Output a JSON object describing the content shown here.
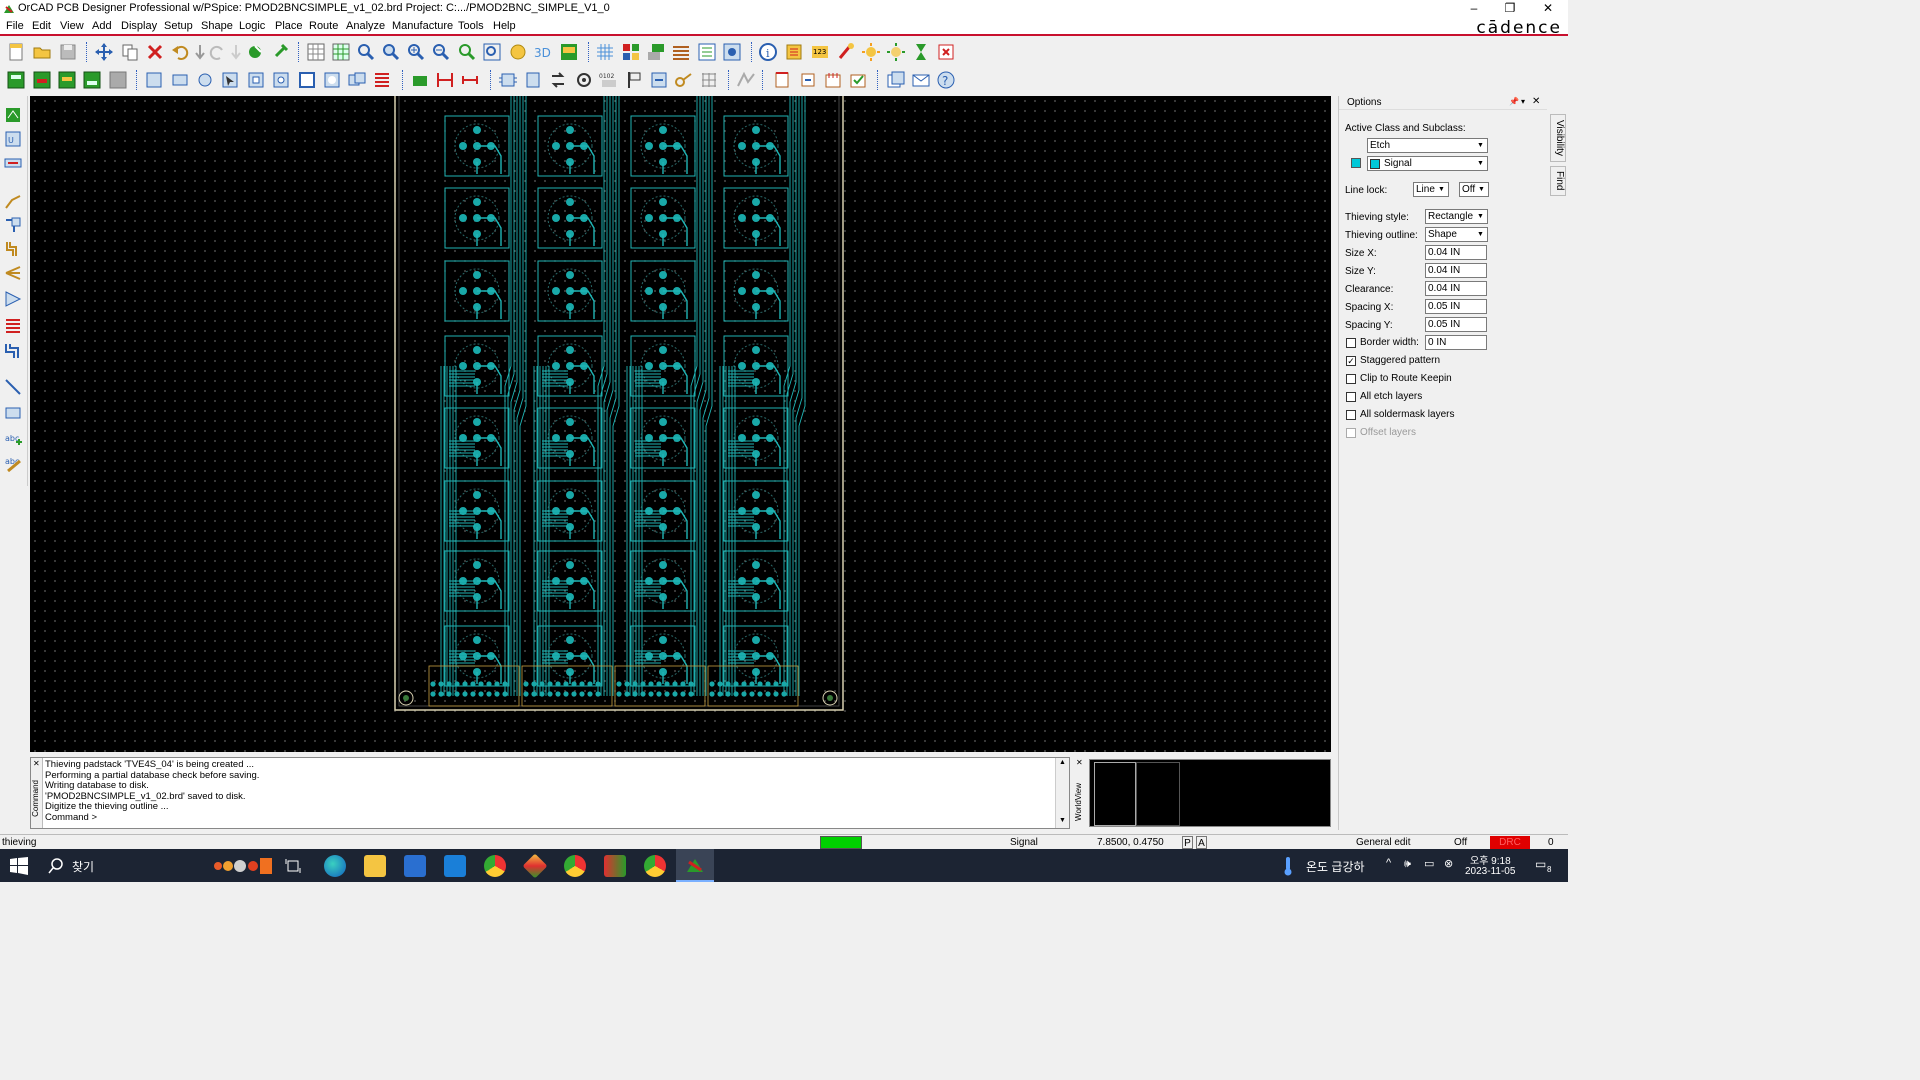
{
  "window": {
    "title": "OrCAD PCB Designer Professional w/PSpice: PMOD2BNCSIMPLE_v1_02.brd  Project: C:.../PMOD2BNC_SIMPLE_V1_0",
    "brand": "cādence",
    "minimize": "–",
    "restore": "❐",
    "close": "✕"
  },
  "menu": [
    "File",
    "Edit",
    "View",
    "Add",
    "Display",
    "Setup",
    "Shape",
    "Logic",
    "Place",
    "Route",
    "Analyze",
    "Manufacture",
    "Tools",
    "Help"
  ],
  "options": {
    "header": "Options",
    "active_class_label": "Active Class and Subclass:",
    "class_value": "Etch",
    "subclass_value": "Signal",
    "subclass_color": "#00c8d8",
    "line_lock_label": "Line lock:",
    "line_lock_value": "Line",
    "line_lock_state": "Off",
    "thieving_style_label": "Thieving style:",
    "thieving_style_value": "Rectangle",
    "thieving_outline_label": "Thieving outline:",
    "thieving_outline_value": "Shape",
    "size_x_label": "Size X:",
    "size_x_value": "0.04 IN",
    "size_y_label": "Size Y:",
    "size_y_value": "0.04 IN",
    "clearance_label": "Clearance:",
    "clearance_value": "0.04 IN",
    "spacing_x_label": "Spacing X:",
    "spacing_x_value": "0.05 IN",
    "spacing_y_label": "Spacing Y:",
    "spacing_y_value": "0.05 IN",
    "border_width_label": "Border width:",
    "border_width_value": "0 IN",
    "staggered_label": "Staggered pattern",
    "clip_label": "Clip to Route Keepin",
    "all_etch_label": "All etch layers",
    "all_soldermask_label": "All soldermask layers",
    "offset_label": "Offset layers"
  },
  "side_tabs": [
    "Visibility",
    "Find"
  ],
  "console": {
    "tab_label": "Command",
    "lines": [
      "Thieving padstack 'TVE4S_04' is being created ...",
      "Performing a partial database check before saving.",
      "Writing database to disk.",
      "'PMOD2BNCSIMPLE_v1_02.brd' saved to disk.",
      "Digitize the thieving outline ...",
      "Command >"
    ]
  },
  "worldview_label": "WorldView",
  "status": {
    "command": "thieving",
    "layer": "Signal",
    "coords": "7.8500, 0.4750",
    "p_btn": "P",
    "a_btn": "A",
    "mode": "General edit",
    "off": "Off",
    "drc": "DRC",
    "drc_count": "0",
    "green_color": "#00d000",
    "drc_color": "#e00000"
  },
  "taskbar": {
    "search_label": "찾기",
    "weather": "온도 급강하",
    "time": "오후 9:18",
    "date": "2023-11-05",
    "notif_count": "8"
  },
  "colors": {
    "trace": "#1fb5b5",
    "pad": "#19a8a8",
    "board_outline": "#d8d0b0",
    "accent": "#c8102e"
  }
}
